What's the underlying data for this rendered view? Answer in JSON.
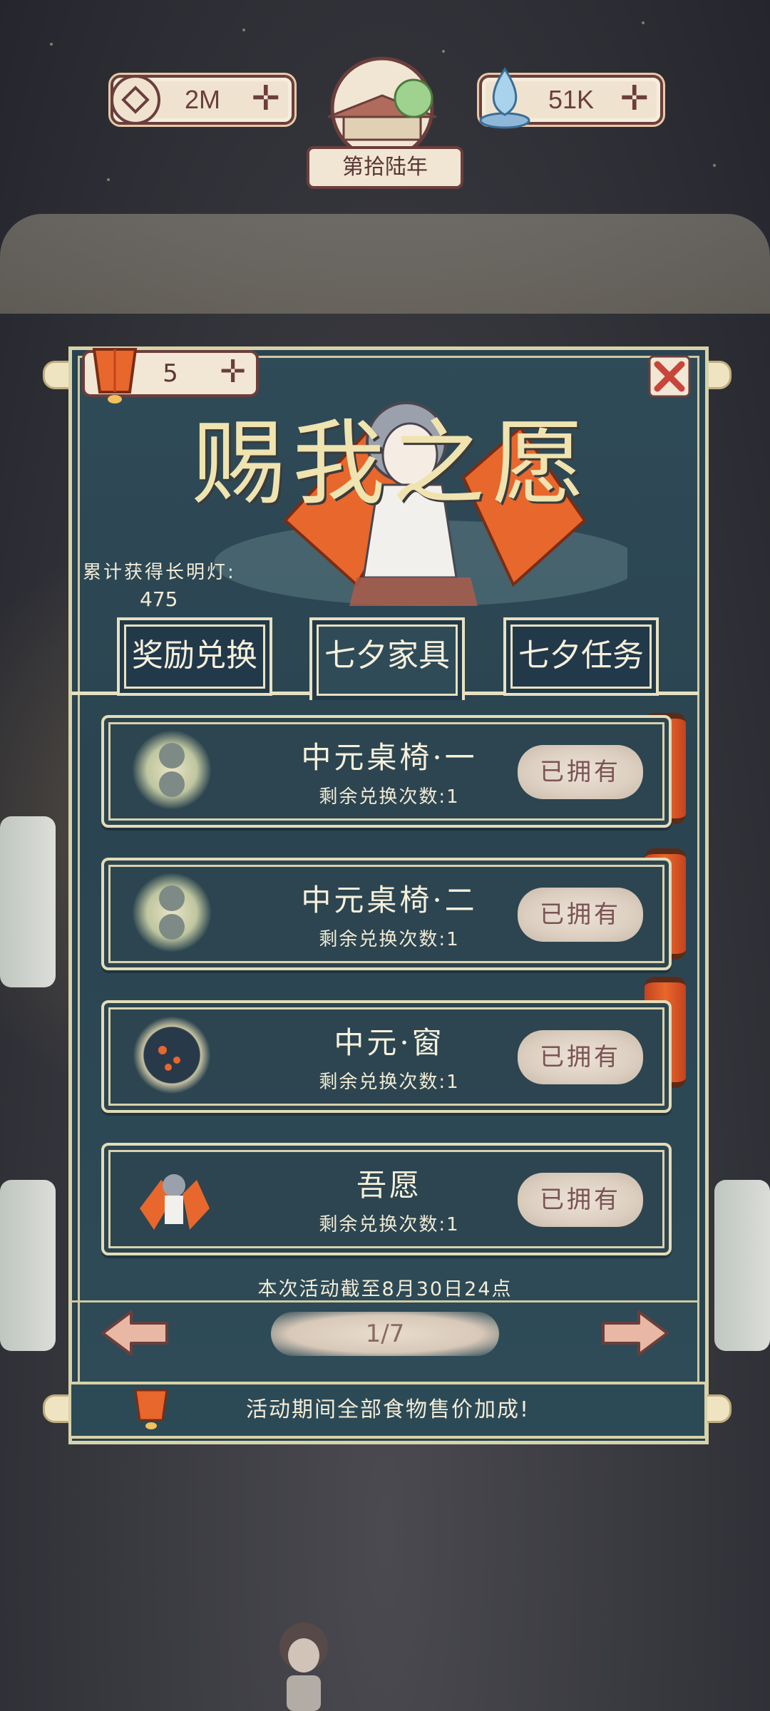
{
  "currency": {
    "coins": "2M",
    "water": "51K"
  },
  "year_label": "第拾陆年",
  "lantern_count": "5",
  "banner": {
    "calligraphy": "赐我之愿"
  },
  "accumulated": {
    "label": "累计获得长明灯:",
    "value": "475"
  },
  "tabs": [
    {
      "label": "奖励兑换"
    },
    {
      "label": "七夕家具"
    },
    {
      "label": "七夕任务"
    }
  ],
  "items": [
    {
      "name": "中元桌椅·一",
      "remaining": "剩余兑换次数:1",
      "status": "已拥有",
      "icon": "lotus-pattern-icon"
    },
    {
      "name": "中元桌椅·二",
      "remaining": "剩余兑换次数:1",
      "status": "已拥有",
      "icon": "lotus-pattern-icon"
    },
    {
      "name": "中元·窗",
      "remaining": "剩余兑换次数:1",
      "status": "已拥有",
      "icon": "round-window-icon"
    },
    {
      "name": "吾愿",
      "remaining": "剩余兑换次数:1",
      "status": "已拥有",
      "icon": "praying-girl-icon"
    }
  ],
  "deadline": "本次活动截至8月30日24点",
  "pagination": "1/7",
  "footer": "活动期间全部食物售价加成!",
  "colors": {
    "panel": "#2f4b57",
    "border": "#d8d2a8",
    "lantern": "#e8672c",
    "text": "#f3ecd8"
  }
}
